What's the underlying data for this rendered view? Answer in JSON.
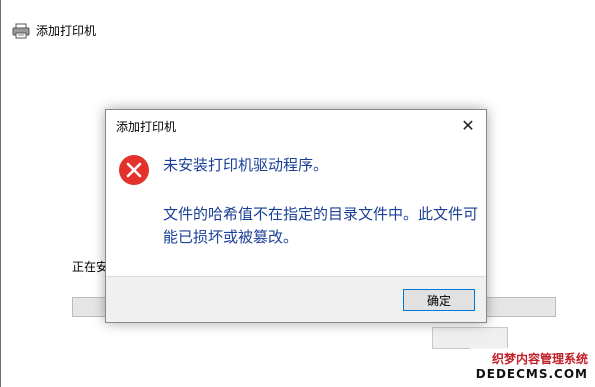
{
  "window": {
    "title": "添加打印机",
    "status_text": "正在安"
  },
  "dialog": {
    "title": "添加打印机",
    "close_symbol": "✕",
    "message_main": "未安装打印机驱动程序。",
    "message_detail": "文件的哈希值不在指定的目录文件中。此文件可能已损坏或被篡改。",
    "ok_label": "确定"
  },
  "watermark": {
    "line1": "织梦内容管理系统",
    "line2": "DEDECMS.COM"
  },
  "colors": {
    "message_text": "#1a3f96",
    "error_icon": "#e4312b",
    "focus_border": "#0078d7"
  },
  "icons": {
    "header": "printer-icon",
    "error": "error-icon",
    "close": "close-icon"
  }
}
